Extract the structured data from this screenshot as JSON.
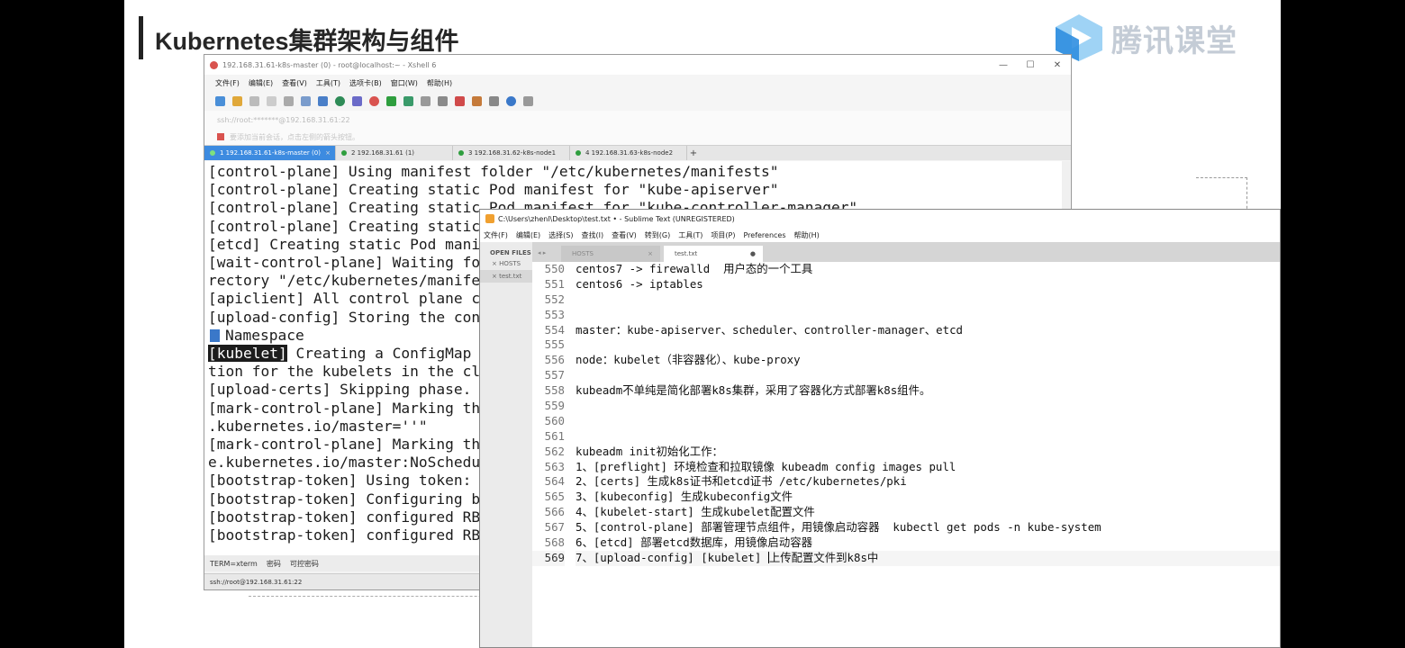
{
  "slide": {
    "title": "Kubernetes集群架构与组件",
    "logo_text": "腾讯课堂",
    "logo_icon": "play-triangle-icon",
    "accent_color": "#3fa9f5"
  },
  "xshell": {
    "title": "192.168.31.61-k8s-master (0) - root@localhost:~ - Xshell 6",
    "window_buttons": [
      "—",
      "☐",
      "✕"
    ],
    "menu": [
      "文件(F)",
      "编辑(E)",
      "查看(V)",
      "工具(T)",
      "选项卡(B)",
      "窗口(W)",
      "帮助(H)"
    ],
    "address": "ssh://root:*******@192.168.31.61:22",
    "tip": "要添加当前会话，点击左侧的箭头按钮。",
    "tabs": [
      {
        "label": "1 192.168.31.61-k8s-master (0)",
        "active": true
      },
      {
        "label": "2 192.168.31.61 (1)",
        "active": false
      },
      {
        "label": "3 192.168.31.62-k8s-node1",
        "active": false
      },
      {
        "label": "4 192.168.31.63-k8s-node2",
        "active": false
      }
    ],
    "tab_add": "+",
    "terminal_lines": [
      "[control-plane] Using manifest folder \"/etc/kubernetes/manifests\"",
      "[control-plane] Creating static Pod manifest for \"kube-apiserver\"",
      "[control-plane] Creating static Pod manifest for \"kube-controller-manager\"",
      "[control-plane] Creating static",
      "[etcd] Creating static Pod mani",
      "[wait-control-plane] Waiting fo",
      "rectory \"/etc/kubernetes/manife",
      "[apiclient] All control plane c",
      "[upload-config] Storing the con",
      "Namespace",
      "[kubelet]",
      " Creating a ConfigMap",
      "tion for the kubelets in the cl",
      "[upload-certs] Skipping phase.",
      "[mark-control-plane] Marking th",
      ".kubernetes.io/master=''\"",
      "[mark-control-plane] Marking th",
      "e.kubernetes.io/master:NoSchedu",
      "[bootstrap-token] Using token:",
      "[bootstrap-token] Configuring b",
      "[bootstrap-token] configured RB",
      "[bootstrap-token] configured RB"
    ],
    "status": [
      "TERM=xterm",
      "密码",
      "可控密码"
    ],
    "bottom": "ssh://root@192.168.31.61:22"
  },
  "sublime": {
    "title": "C:\\Users\\zhenl\\Desktop\\test.txt • - Sublime Text (UNREGISTERED)",
    "menu": [
      "文件(F)",
      "编辑(E)",
      "选择(S)",
      "查找(I)",
      "查看(V)",
      "转到(G)",
      "工具(T)",
      "项目(P)",
      "Preferences",
      "帮助(H)"
    ],
    "sidebar_header": "OPEN FILES",
    "sidebar_files": [
      "HOSTS",
      "test.txt"
    ],
    "tabs": [
      "HOSTS",
      "test.txt"
    ],
    "tab_nav": "◂ ▸",
    "line_numbers": [
      "550",
      "551",
      "552",
      "553",
      "554",
      "555",
      "556",
      "557",
      "558",
      "559",
      "560",
      "561",
      "562",
      "563",
      "564",
      "565",
      "566",
      "567",
      "568",
      "569"
    ],
    "lines": [
      "centos7 -> firewalld  用户态的一个工具",
      "centos6 -> iptables",
      "",
      "",
      "master：kube-apiserver、scheduler、controller-manager、etcd",
      "",
      "node：kubelet（非容器化）、kube-proxy",
      "",
      "kubeadm不单纯是简化部署k8s集群，采用了容器化方式部署k8s组件。",
      "",
      "",
      "",
      "kubeadm init初始化工作：",
      "1、[preflight] 环境检查和拉取镜像 kubeadm config images pull",
      "2、[certs] 生成k8s证书和etcd证书 /etc/kubernetes/pki",
      "3、[kubeconfig] 生成kubeconfig文件",
      "4、[kubelet-start] 生成kubelet配置文件",
      "5、[control-plane] 部署管理节点组件，用镜像启动容器  kubectl get pods -n kube-system",
      "6、[etcd] 部署etcd数据库，用镜像启动容器",
      "7、[upload-config] [kubelet] "
    ],
    "line_569_rest": "上传配置文件到k8s中"
  }
}
